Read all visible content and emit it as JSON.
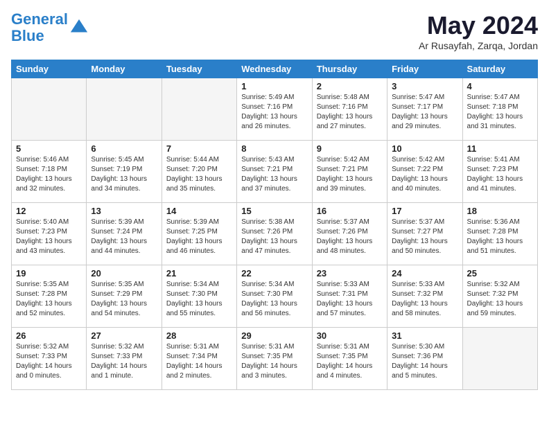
{
  "logo": {
    "line1": "General",
    "line2": "Blue"
  },
  "title": "May 2024",
  "location": "Ar Rusayfah, Zarqa, Jordan",
  "headers": [
    "Sunday",
    "Monday",
    "Tuesday",
    "Wednesday",
    "Thursday",
    "Friday",
    "Saturday"
  ],
  "weeks": [
    [
      {
        "day": "",
        "info": "",
        "empty": true
      },
      {
        "day": "",
        "info": "",
        "empty": true
      },
      {
        "day": "",
        "info": "",
        "empty": true
      },
      {
        "day": "1",
        "info": "Sunrise: 5:49 AM\nSunset: 7:16 PM\nDaylight: 13 hours\nand 26 minutes.",
        "empty": false
      },
      {
        "day": "2",
        "info": "Sunrise: 5:48 AM\nSunset: 7:16 PM\nDaylight: 13 hours\nand 27 minutes.",
        "empty": false
      },
      {
        "day": "3",
        "info": "Sunrise: 5:47 AM\nSunset: 7:17 PM\nDaylight: 13 hours\nand 29 minutes.",
        "empty": false
      },
      {
        "day": "4",
        "info": "Sunrise: 5:47 AM\nSunset: 7:18 PM\nDaylight: 13 hours\nand 31 minutes.",
        "empty": false
      }
    ],
    [
      {
        "day": "5",
        "info": "Sunrise: 5:46 AM\nSunset: 7:18 PM\nDaylight: 13 hours\nand 32 minutes.",
        "empty": false
      },
      {
        "day": "6",
        "info": "Sunrise: 5:45 AM\nSunset: 7:19 PM\nDaylight: 13 hours\nand 34 minutes.",
        "empty": false
      },
      {
        "day": "7",
        "info": "Sunrise: 5:44 AM\nSunset: 7:20 PM\nDaylight: 13 hours\nand 35 minutes.",
        "empty": false
      },
      {
        "day": "8",
        "info": "Sunrise: 5:43 AM\nSunset: 7:21 PM\nDaylight: 13 hours\nand 37 minutes.",
        "empty": false
      },
      {
        "day": "9",
        "info": "Sunrise: 5:42 AM\nSunset: 7:21 PM\nDaylight: 13 hours\nand 39 minutes.",
        "empty": false
      },
      {
        "day": "10",
        "info": "Sunrise: 5:42 AM\nSunset: 7:22 PM\nDaylight: 13 hours\nand 40 minutes.",
        "empty": false
      },
      {
        "day": "11",
        "info": "Sunrise: 5:41 AM\nSunset: 7:23 PM\nDaylight: 13 hours\nand 41 minutes.",
        "empty": false
      }
    ],
    [
      {
        "day": "12",
        "info": "Sunrise: 5:40 AM\nSunset: 7:23 PM\nDaylight: 13 hours\nand 43 minutes.",
        "empty": false
      },
      {
        "day": "13",
        "info": "Sunrise: 5:39 AM\nSunset: 7:24 PM\nDaylight: 13 hours\nand 44 minutes.",
        "empty": false
      },
      {
        "day": "14",
        "info": "Sunrise: 5:39 AM\nSunset: 7:25 PM\nDaylight: 13 hours\nand 46 minutes.",
        "empty": false
      },
      {
        "day": "15",
        "info": "Sunrise: 5:38 AM\nSunset: 7:26 PM\nDaylight: 13 hours\nand 47 minutes.",
        "empty": false
      },
      {
        "day": "16",
        "info": "Sunrise: 5:37 AM\nSunset: 7:26 PM\nDaylight: 13 hours\nand 48 minutes.",
        "empty": false
      },
      {
        "day": "17",
        "info": "Sunrise: 5:37 AM\nSunset: 7:27 PM\nDaylight: 13 hours\nand 50 minutes.",
        "empty": false
      },
      {
        "day": "18",
        "info": "Sunrise: 5:36 AM\nSunset: 7:28 PM\nDaylight: 13 hours\nand 51 minutes.",
        "empty": false
      }
    ],
    [
      {
        "day": "19",
        "info": "Sunrise: 5:35 AM\nSunset: 7:28 PM\nDaylight: 13 hours\nand 52 minutes.",
        "empty": false
      },
      {
        "day": "20",
        "info": "Sunrise: 5:35 AM\nSunset: 7:29 PM\nDaylight: 13 hours\nand 54 minutes.",
        "empty": false
      },
      {
        "day": "21",
        "info": "Sunrise: 5:34 AM\nSunset: 7:30 PM\nDaylight: 13 hours\nand 55 minutes.",
        "empty": false
      },
      {
        "day": "22",
        "info": "Sunrise: 5:34 AM\nSunset: 7:30 PM\nDaylight: 13 hours\nand 56 minutes.",
        "empty": false
      },
      {
        "day": "23",
        "info": "Sunrise: 5:33 AM\nSunset: 7:31 PM\nDaylight: 13 hours\nand 57 minutes.",
        "empty": false
      },
      {
        "day": "24",
        "info": "Sunrise: 5:33 AM\nSunset: 7:32 PM\nDaylight: 13 hours\nand 58 minutes.",
        "empty": false
      },
      {
        "day": "25",
        "info": "Sunrise: 5:32 AM\nSunset: 7:32 PM\nDaylight: 13 hours\nand 59 minutes.",
        "empty": false
      }
    ],
    [
      {
        "day": "26",
        "info": "Sunrise: 5:32 AM\nSunset: 7:33 PM\nDaylight: 14 hours\nand 0 minutes.",
        "empty": false
      },
      {
        "day": "27",
        "info": "Sunrise: 5:32 AM\nSunset: 7:33 PM\nDaylight: 14 hours\nand 1 minute.",
        "empty": false
      },
      {
        "day": "28",
        "info": "Sunrise: 5:31 AM\nSunset: 7:34 PM\nDaylight: 14 hours\nand 2 minutes.",
        "empty": false
      },
      {
        "day": "29",
        "info": "Sunrise: 5:31 AM\nSunset: 7:35 PM\nDaylight: 14 hours\nand 3 minutes.",
        "empty": false
      },
      {
        "day": "30",
        "info": "Sunrise: 5:31 AM\nSunset: 7:35 PM\nDaylight: 14 hours\nand 4 minutes.",
        "empty": false
      },
      {
        "day": "31",
        "info": "Sunrise: 5:30 AM\nSunset: 7:36 PM\nDaylight: 14 hours\nand 5 minutes.",
        "empty": false
      },
      {
        "day": "",
        "info": "",
        "empty": true
      }
    ]
  ]
}
